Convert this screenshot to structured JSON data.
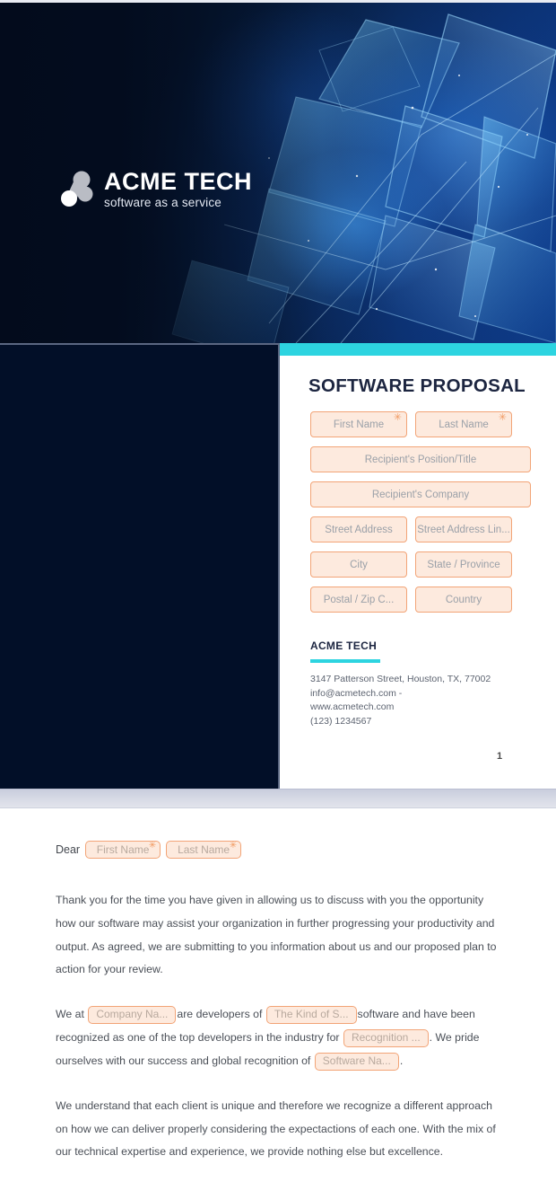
{
  "brand": {
    "name": "ACME TECH",
    "tagline": "software as a service",
    "logo_icon": "three-circles-molecule-logo",
    "accent_cyan": "#2dd4e0",
    "navy": "#020f28",
    "field_fill": "#fdeade",
    "field_border": "#f2a477"
  },
  "page1": {
    "title": "SOFTWARE PROPOSAL",
    "form_rows": [
      [
        {
          "label": "First Name",
          "required": true,
          "width": "half"
        },
        {
          "label": "Last Name",
          "required": true,
          "width": "half"
        }
      ],
      [
        {
          "label": "Recipient's Position/Title",
          "required": false,
          "width": "full"
        }
      ],
      [
        {
          "label": "Recipient's Company",
          "required": false,
          "width": "full"
        }
      ],
      [
        {
          "label": "Street Address",
          "required": false,
          "width": "half"
        },
        {
          "label": "Street Address Lin...",
          "required": false,
          "width": "half"
        }
      ],
      [
        {
          "label": "City",
          "required": false,
          "width": "half"
        },
        {
          "label": "State / Province",
          "required": false,
          "width": "half"
        }
      ],
      [
        {
          "label": "Postal / Zip C...",
          "required": false,
          "width": "half"
        },
        {
          "label": "Country",
          "required": false,
          "width": "half"
        }
      ]
    ],
    "contact": {
      "name": "ACME TECH",
      "address": "3147 Patterson Street, Houston, TX, 77002",
      "email_line": "info@acmetech.com -",
      "website": "www.acmetech.com",
      "phone": "(123) 1234567"
    },
    "page_number": "1"
  },
  "page2": {
    "greeting": {
      "word": "Dear",
      "first_name_field": "First Name",
      "last_name_field": "Last Name"
    },
    "paragraph1": "Thank you for the time you have given in allowing us to discuss with you the opportunity how our software may assist your organization in further progressing your productivity and output. As agreed, we are submitting to you information about us and our proposed plan to action for your review.",
    "paragraph2": {
      "seg1": "We at",
      "field_company": "Company Na...",
      "seg2": "are developers of",
      "field_kind": "The Kind of S...",
      "seg3": "software and have been recognized as one of the top developers in the industry for",
      "field_recognition": "Recognition ...",
      "seg4": ". We pride ourselves with our success and global recognition of",
      "field_software": "Software Na...",
      "seg5": "."
    },
    "paragraph3": "We understand that each client is unique and therefore we recognize a different approach on how we can deliver properly considering the expectactions of each one. With the mix of our technical expertise and experience, we provide nothing else but excellence."
  }
}
